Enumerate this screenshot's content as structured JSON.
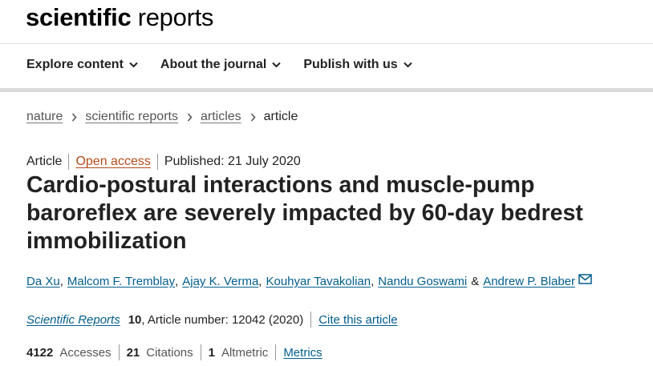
{
  "brand": {
    "bold": "scientific",
    "light": "reports"
  },
  "nav": {
    "items": [
      "Explore content",
      "About the journal",
      "Publish with us"
    ]
  },
  "breadcrumb": {
    "links": [
      "nature",
      "scientific reports",
      "articles"
    ],
    "current": "article"
  },
  "meta": {
    "type": "Article",
    "access": "Open access",
    "published": "Published: 21 July 2020"
  },
  "title": "Cardio-postural interactions and muscle-pump baroreflex are severely impacted by 60-day bedrest immobilization",
  "authors": {
    "list": [
      "Da Xu",
      "Malcom F. Tremblay",
      "Ajay K. Verma",
      "Kouhyar Tavakolian",
      "Nandu Goswami",
      "Andrew P. Blaber"
    ],
    "comma": ",",
    "amp": "&"
  },
  "citation": {
    "journal": "Scientific Reports",
    "volume": "10",
    "rest": ", Article number: 12042 (2020)",
    "cite_link": "Cite this article"
  },
  "stats": {
    "accesses_num": "4122",
    "accesses_label": "Accesses",
    "citations_num": "21",
    "citations_label": "Citations",
    "altmetric_num": "1",
    "altmetric_label": "Altmetric",
    "metrics_link": "Metrics"
  },
  "colors": {
    "link": "#025e8d",
    "open_access": "#b54a1a",
    "text": "#222222"
  }
}
